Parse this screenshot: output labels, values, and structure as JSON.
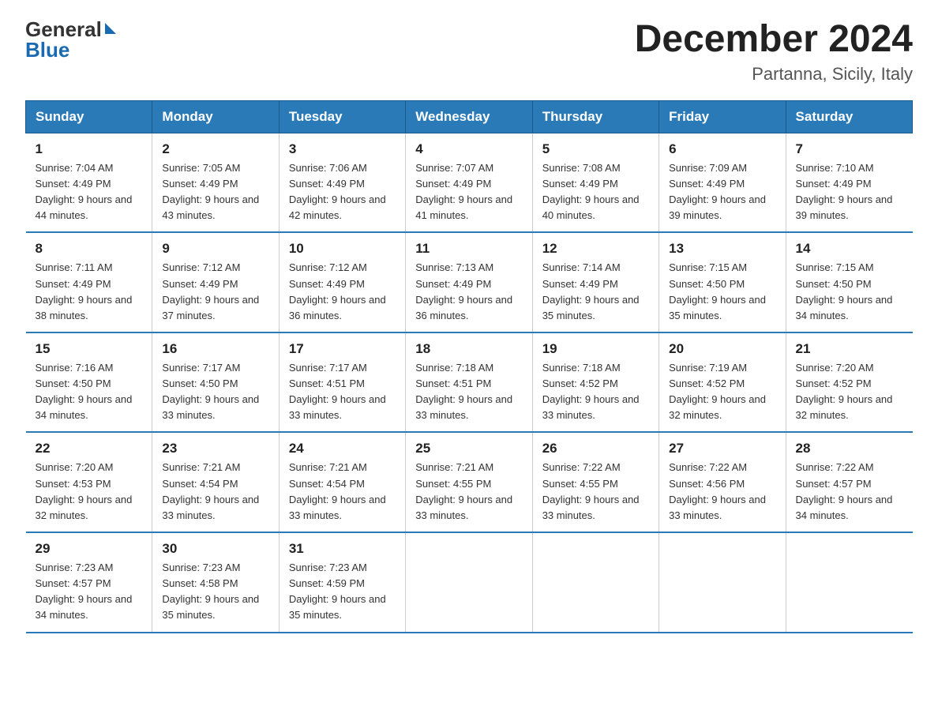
{
  "header": {
    "logo_general": "General",
    "logo_blue": "Blue",
    "month_title": "December 2024",
    "location": "Partanna, Sicily, Italy"
  },
  "days_of_week": [
    "Sunday",
    "Monday",
    "Tuesday",
    "Wednesday",
    "Thursday",
    "Friday",
    "Saturday"
  ],
  "weeks": [
    [
      {
        "day": "1",
        "sunrise": "7:04 AM",
        "sunset": "4:49 PM",
        "daylight": "9 hours and 44 minutes."
      },
      {
        "day": "2",
        "sunrise": "7:05 AM",
        "sunset": "4:49 PM",
        "daylight": "9 hours and 43 minutes."
      },
      {
        "day": "3",
        "sunrise": "7:06 AM",
        "sunset": "4:49 PM",
        "daylight": "9 hours and 42 minutes."
      },
      {
        "day": "4",
        "sunrise": "7:07 AM",
        "sunset": "4:49 PM",
        "daylight": "9 hours and 41 minutes."
      },
      {
        "day": "5",
        "sunrise": "7:08 AM",
        "sunset": "4:49 PM",
        "daylight": "9 hours and 40 minutes."
      },
      {
        "day": "6",
        "sunrise": "7:09 AM",
        "sunset": "4:49 PM",
        "daylight": "9 hours and 39 minutes."
      },
      {
        "day": "7",
        "sunrise": "7:10 AM",
        "sunset": "4:49 PM",
        "daylight": "9 hours and 39 minutes."
      }
    ],
    [
      {
        "day": "8",
        "sunrise": "7:11 AM",
        "sunset": "4:49 PM",
        "daylight": "9 hours and 38 minutes."
      },
      {
        "day": "9",
        "sunrise": "7:12 AM",
        "sunset": "4:49 PM",
        "daylight": "9 hours and 37 minutes."
      },
      {
        "day": "10",
        "sunrise": "7:12 AM",
        "sunset": "4:49 PM",
        "daylight": "9 hours and 36 minutes."
      },
      {
        "day": "11",
        "sunrise": "7:13 AM",
        "sunset": "4:49 PM",
        "daylight": "9 hours and 36 minutes."
      },
      {
        "day": "12",
        "sunrise": "7:14 AM",
        "sunset": "4:49 PM",
        "daylight": "9 hours and 35 minutes."
      },
      {
        "day": "13",
        "sunrise": "7:15 AM",
        "sunset": "4:50 PM",
        "daylight": "9 hours and 35 minutes."
      },
      {
        "day": "14",
        "sunrise": "7:15 AM",
        "sunset": "4:50 PM",
        "daylight": "9 hours and 34 minutes."
      }
    ],
    [
      {
        "day": "15",
        "sunrise": "7:16 AM",
        "sunset": "4:50 PM",
        "daylight": "9 hours and 34 minutes."
      },
      {
        "day": "16",
        "sunrise": "7:17 AM",
        "sunset": "4:50 PM",
        "daylight": "9 hours and 33 minutes."
      },
      {
        "day": "17",
        "sunrise": "7:17 AM",
        "sunset": "4:51 PM",
        "daylight": "9 hours and 33 minutes."
      },
      {
        "day": "18",
        "sunrise": "7:18 AM",
        "sunset": "4:51 PM",
        "daylight": "9 hours and 33 minutes."
      },
      {
        "day": "19",
        "sunrise": "7:18 AM",
        "sunset": "4:52 PM",
        "daylight": "9 hours and 33 minutes."
      },
      {
        "day": "20",
        "sunrise": "7:19 AM",
        "sunset": "4:52 PM",
        "daylight": "9 hours and 32 minutes."
      },
      {
        "day": "21",
        "sunrise": "7:20 AM",
        "sunset": "4:52 PM",
        "daylight": "9 hours and 32 minutes."
      }
    ],
    [
      {
        "day": "22",
        "sunrise": "7:20 AM",
        "sunset": "4:53 PM",
        "daylight": "9 hours and 32 minutes."
      },
      {
        "day": "23",
        "sunrise": "7:21 AM",
        "sunset": "4:54 PM",
        "daylight": "9 hours and 33 minutes."
      },
      {
        "day": "24",
        "sunrise": "7:21 AM",
        "sunset": "4:54 PM",
        "daylight": "9 hours and 33 minutes."
      },
      {
        "day": "25",
        "sunrise": "7:21 AM",
        "sunset": "4:55 PM",
        "daylight": "9 hours and 33 minutes."
      },
      {
        "day": "26",
        "sunrise": "7:22 AM",
        "sunset": "4:55 PM",
        "daylight": "9 hours and 33 minutes."
      },
      {
        "day": "27",
        "sunrise": "7:22 AM",
        "sunset": "4:56 PM",
        "daylight": "9 hours and 33 minutes."
      },
      {
        "day": "28",
        "sunrise": "7:22 AM",
        "sunset": "4:57 PM",
        "daylight": "9 hours and 34 minutes."
      }
    ],
    [
      {
        "day": "29",
        "sunrise": "7:23 AM",
        "sunset": "4:57 PM",
        "daylight": "9 hours and 34 minutes."
      },
      {
        "day": "30",
        "sunrise": "7:23 AM",
        "sunset": "4:58 PM",
        "daylight": "9 hours and 35 minutes."
      },
      {
        "day": "31",
        "sunrise": "7:23 AM",
        "sunset": "4:59 PM",
        "daylight": "9 hours and 35 minutes."
      },
      null,
      null,
      null,
      null
    ]
  ]
}
